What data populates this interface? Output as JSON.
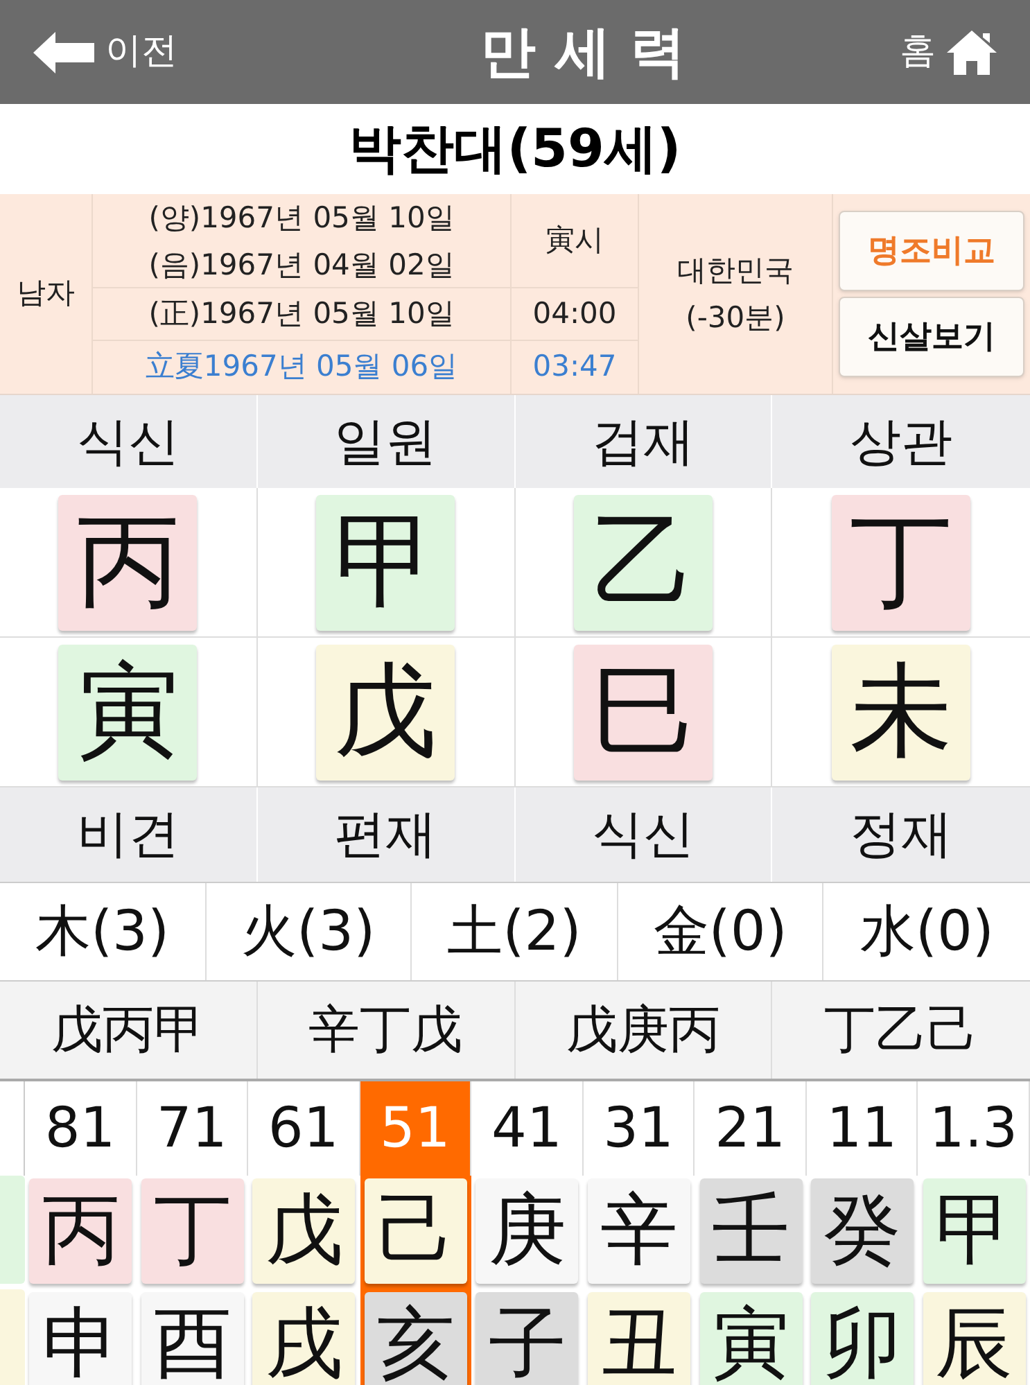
{
  "header": {
    "back": "이전",
    "title": "만 세 력",
    "home": "홈"
  },
  "name": "박찬대(59세)",
  "info": {
    "gender": "남자",
    "solar": "(양)1967년 05월 10일",
    "lunar": "(음)1967년 04월 02일",
    "hour_pillar": "寅시",
    "corrected": "(正)1967년 05월 10일",
    "corrected_time": "04:00",
    "term": "立夏1967년 05월 06일",
    "term_time": "03:47",
    "place": "대한민국",
    "offset": "(-30분)",
    "buttons": [
      {
        "label": "명조비교",
        "kind": "accent"
      },
      {
        "label": "신살보기",
        "kind": "plain"
      }
    ]
  },
  "pillars": [
    {
      "top_label": "식신",
      "stem": {
        "char": "丙",
        "color": "#f9dfe0"
      },
      "branch": {
        "char": "寅",
        "color": "#e0f6e0"
      },
      "bottom_label": "비견"
    },
    {
      "top_label": "일원",
      "stem": {
        "char": "甲",
        "color": "#e0f6e0"
      },
      "branch": {
        "char": "戊",
        "color": "#faf6dd"
      },
      "bottom_label": "편재"
    },
    {
      "top_label": "겁재",
      "stem": {
        "char": "乙",
        "color": "#e0f6e0"
      },
      "branch": {
        "char": "巳",
        "color": "#f9dfe0"
      },
      "bottom_label": "식신"
    },
    {
      "top_label": "상관",
      "stem": {
        "char": "丁",
        "color": "#f9dfe0"
      },
      "branch": {
        "char": "未",
        "color": "#faf6dd"
      },
      "bottom_label": "정재"
    }
  ],
  "elements": [
    "木(3)",
    "火(3)",
    "土(2)",
    "金(0)",
    "水(0)"
  ],
  "hidden_stems": [
    "戊丙甲",
    "辛丁戊",
    "戊庚丙",
    "丁乙己"
  ],
  "luck": [
    {
      "age": "81",
      "stem": {
        "char": "丙",
        "color": "#f9dfe0"
      },
      "branch": {
        "char": "申",
        "color": "#f7f7f7"
      },
      "selected": false
    },
    {
      "age": "71",
      "stem": {
        "char": "丁",
        "color": "#f9dfe0"
      },
      "branch": {
        "char": "酉",
        "color": "#f7f7f7"
      },
      "selected": false
    },
    {
      "age": "61",
      "stem": {
        "char": "戊",
        "color": "#faf6dd"
      },
      "branch": {
        "char": "戌",
        "color": "#faf6dd"
      },
      "selected": false
    },
    {
      "age": "51",
      "stem": {
        "char": "己",
        "color": "#faf6dd"
      },
      "branch": {
        "char": "亥",
        "color": "#dcdcdc"
      },
      "selected": true
    },
    {
      "age": "41",
      "stem": {
        "char": "庚",
        "color": "#f7f7f7"
      },
      "branch": {
        "char": "子",
        "color": "#dcdcdc"
      },
      "selected": false
    },
    {
      "age": "31",
      "stem": {
        "char": "辛",
        "color": "#f7f7f7"
      },
      "branch": {
        "char": "丑",
        "color": "#faf6dd"
      },
      "selected": false
    },
    {
      "age": "21",
      "stem": {
        "char": "壬",
        "color": "#dcdcdc"
      },
      "branch": {
        "char": "寅",
        "color": "#e0f6e0"
      },
      "selected": false
    },
    {
      "age": "11",
      "stem": {
        "char": "癸",
        "color": "#dcdcdc"
      },
      "branch": {
        "char": "卯",
        "color": "#e0f6e0"
      },
      "selected": false
    },
    {
      "age": "1.3",
      "stem": {
        "char": "甲",
        "color": "#e0f6e0"
      },
      "branch": {
        "char": "辰",
        "color": "#faf6dd"
      },
      "selected": false
    }
  ]
}
